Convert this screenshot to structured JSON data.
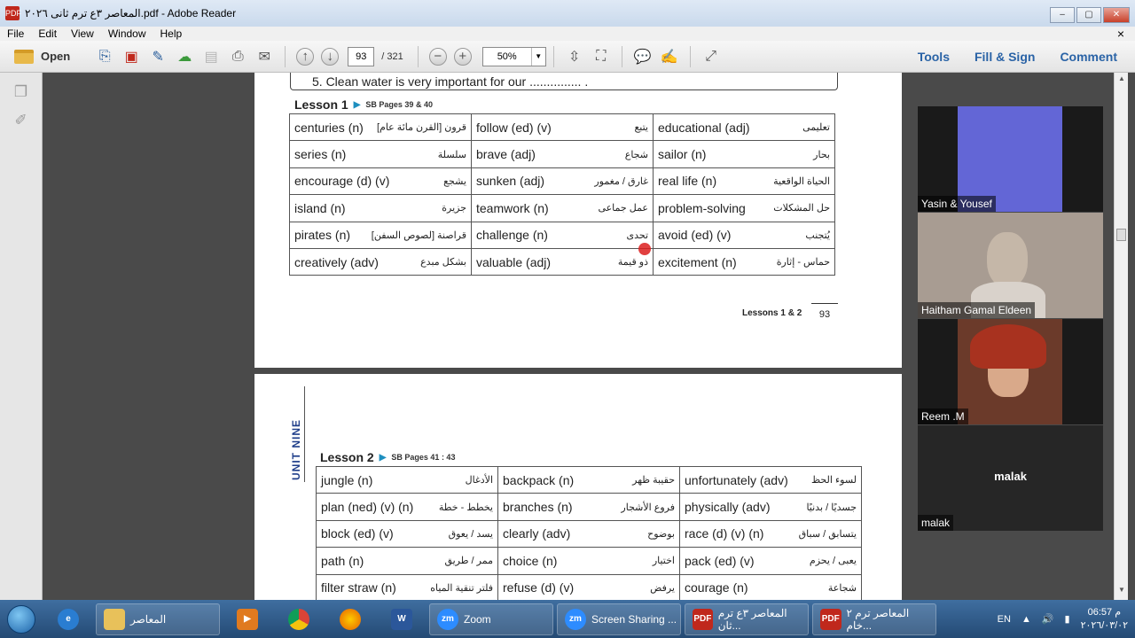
{
  "window": {
    "title": "المعاصر ٣ع ترم ثانى ٢٠٢٦.pdf - Adobe Reader",
    "icon_text": "PDF",
    "min": "‒",
    "max": "▢",
    "close": "✕"
  },
  "menu": {
    "items": [
      "File",
      "Edit",
      "View",
      "Window",
      "Help"
    ],
    "close": "×"
  },
  "toolbar": {
    "open_label": "Open",
    "page_current": "93",
    "page_total": "/ 321",
    "zoom": "50%",
    "zoom_dropdown": "▼",
    "tools_label": "Tools",
    "fill_sign_label": "Fill & Sign",
    "comment_label": "Comment",
    "zoom_out": "−",
    "zoom_in": "+"
  },
  "doc": {
    "page1": {
      "question": "5. Clean water is very important for our ............... .",
      "lesson_label": "Lesson 1",
      "lesson_pages": "SB Pages 39 & 40",
      "rows": [
        [
          [
            "centuries (n)",
            "قرون [القرن مائة عام]"
          ],
          [
            "follow (ed) (v)",
            "يتبع"
          ],
          [
            "educational (adj)",
            "تعليمى"
          ]
        ],
        [
          [
            "series (n)",
            "سلسلة"
          ],
          [
            "brave (adj)",
            "شجاع"
          ],
          [
            "sailor (n)",
            "بحار"
          ]
        ],
        [
          [
            "encourage (d) (v)",
            "يشجع"
          ],
          [
            "sunken (adj)",
            "غارق / مغمور"
          ],
          [
            "real life (n)",
            "الحياة الواقعية"
          ]
        ],
        [
          [
            "island (n)",
            "جزيرة"
          ],
          [
            "teamwork (n)",
            "عمل جماعى"
          ],
          [
            "problem-solving",
            "حل المشكلات"
          ]
        ],
        [
          [
            "pirates (n)",
            "قراصنة [لصوص السفن]"
          ],
          [
            "challenge (n)",
            "تحدى"
          ],
          [
            "avoid (ed) (v)",
            "يُتجنب"
          ]
        ],
        [
          [
            "creatively (adv)",
            "بشكل مبدع"
          ],
          [
            "valuable (adj)",
            "ذو قيمة"
          ],
          [
            "excitement (n)",
            "حماس - إثارة"
          ]
        ]
      ],
      "footer_lessons": "Lessons 1 & 2",
      "footer_page": "93"
    },
    "page2": {
      "unit_label": "UNIT NINE",
      "lesson_label": "Lesson 2",
      "lesson_pages": "SB Pages 41 : 43",
      "rows": [
        [
          [
            "jungle (n)",
            "الأدغال"
          ],
          [
            "backpack (n)",
            "حقيبة ظهر"
          ],
          [
            "unfortunately (adv)",
            "لسوء الحظ"
          ]
        ],
        [
          [
            "plan (ned) (v) (n)",
            "يخطط - خطة"
          ],
          [
            "branches (n)",
            "فروع الأشجار"
          ],
          [
            "physically (adv)",
            "جسديًا / بدنيًا"
          ]
        ],
        [
          [
            "block (ed) (v)",
            "يسد / يعوق"
          ],
          [
            "clearly (adv)",
            "بوضوح"
          ],
          [
            "race (d) (v) (n)",
            "يتسابق / سباق"
          ]
        ],
        [
          [
            "path (n)",
            "ممر / طريق"
          ],
          [
            "choice (n)",
            "اختيار"
          ],
          [
            "pack (ed) (v)",
            "يعبى / يحزم"
          ]
        ],
        [
          [
            "filter straw (n)",
            "فلتر تنقية المياه"
          ],
          [
            "refuse (d) (v)",
            "يرفض"
          ],
          [
            "courage (n)",
            "شجاعة"
          ]
        ]
      ]
    }
  },
  "zoom_panel": {
    "participants": [
      {
        "name": "Yasin & Yousef",
        "bg": "#6366d6"
      },
      {
        "name": "Haitham Gamal Eldeen",
        "bg": "#a89c92"
      },
      {
        "name": "Reem .M",
        "bg": "#6b3a2a"
      },
      {
        "name": "malak",
        "center": "malak",
        "bg": "#262626"
      }
    ]
  },
  "taskbar": {
    "items": [
      {
        "label": "المعاصر",
        "kind": "folder"
      },
      {
        "label": "Zoom",
        "kind": "zoom"
      },
      {
        "label": "Screen Sharing ...",
        "kind": "zoom"
      },
      {
        "label": "المعاصر ٣ع ترم ثان...",
        "kind": "pdf"
      },
      {
        "label": "المعاصر ترم ٢ خام...",
        "kind": "pdf"
      }
    ],
    "lang": "EN",
    "time": "06:57 م",
    "date": "٢٠٢٦/٠٣/٠٢"
  },
  "colors": {
    "accent": "#2a63a6",
    "pdf_red": "#c0281c",
    "zoom_blue": "#2d8cff"
  }
}
